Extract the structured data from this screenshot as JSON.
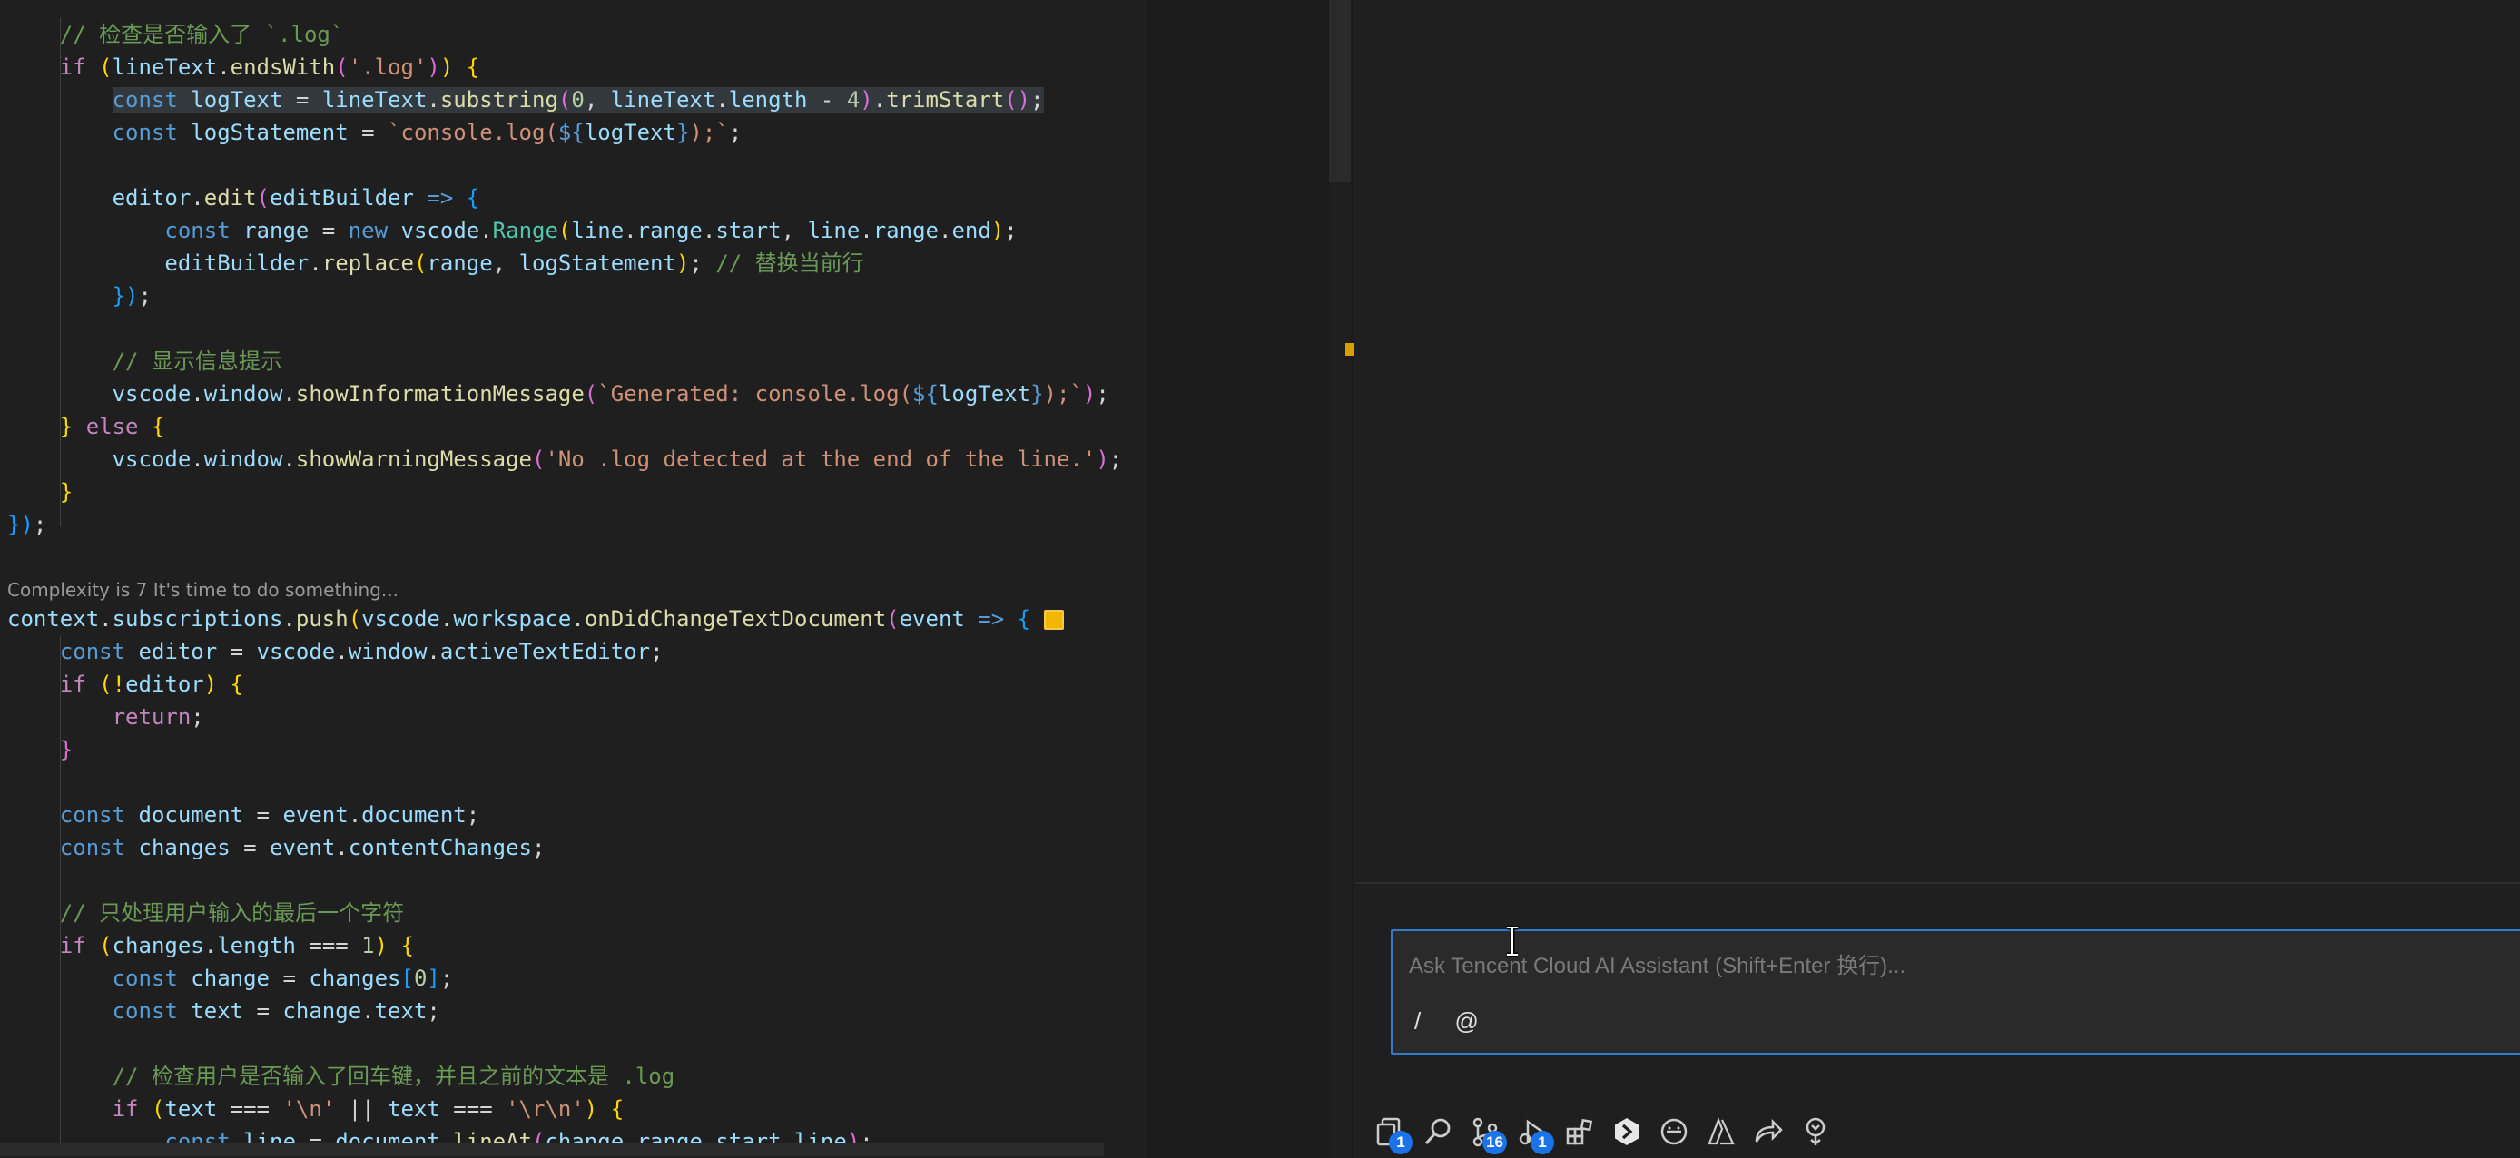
{
  "editor": {
    "codelens": "Complexity is 7 It's time to do something...",
    "lines_top": [
      [
        [
          "    ",
          "pl"
        ],
        [
          "// 检查是否输入了 `.log`",
          "cmt"
        ]
      ],
      [
        [
          "    ",
          "pl"
        ],
        [
          "if",
          "ctl"
        ],
        [
          " (",
          "p1"
        ],
        [
          "lineText",
          "var"
        ],
        [
          ".",
          "pl"
        ],
        [
          "endsWith",
          "fn"
        ],
        [
          "(",
          "p2"
        ],
        [
          "'.log'",
          "str"
        ],
        [
          ")",
          "p2"
        ],
        [
          ")",
          "p1"
        ],
        [
          " {",
          "p1"
        ]
      ],
      [
        [
          "        ",
          "pl"
        ],
        [
          "const",
          "kw"
        ],
        [
          " ",
          "pl"
        ],
        [
          "logText",
          "var"
        ],
        [
          " = ",
          "pl"
        ],
        [
          "lineText",
          "var"
        ],
        [
          ".",
          "pl"
        ],
        [
          "substring",
          "fn"
        ],
        [
          "(",
          "p2"
        ],
        [
          "0",
          "num"
        ],
        [
          ", ",
          "pl"
        ],
        [
          "lineText",
          "var"
        ],
        [
          ".",
          "pl"
        ],
        [
          "length",
          "var"
        ],
        [
          " - ",
          "pl"
        ],
        [
          "4",
          "num"
        ],
        [
          ")",
          "p2"
        ],
        [
          ".",
          "pl"
        ],
        [
          "trimStart",
          "fn"
        ],
        [
          "()",
          "p2"
        ],
        [
          ";",
          "pl"
        ]
      ],
      [
        [
          "        ",
          "pl"
        ],
        [
          "const",
          "kw"
        ],
        [
          " ",
          "pl"
        ],
        [
          "logStatement",
          "var"
        ],
        [
          " = ",
          "pl"
        ],
        [
          "`console.log(",
          "str"
        ],
        [
          "${",
          "kw"
        ],
        [
          "logText",
          "var"
        ],
        [
          "}",
          "kw"
        ],
        [
          ");`",
          "str"
        ],
        [
          ";",
          "pl"
        ]
      ],
      [],
      [
        [
          "        ",
          "pl"
        ],
        [
          "editor",
          "var"
        ],
        [
          ".",
          "pl"
        ],
        [
          "edit",
          "fn"
        ],
        [
          "(",
          "p2"
        ],
        [
          "editBuilder",
          "var"
        ],
        [
          " => ",
          "kw"
        ],
        [
          "{",
          "p3"
        ]
      ],
      [
        [
          "            ",
          "pl"
        ],
        [
          "const",
          "kw"
        ],
        [
          " ",
          "pl"
        ],
        [
          "range",
          "var"
        ],
        [
          " = ",
          "pl"
        ],
        [
          "new",
          "kw"
        ],
        [
          " ",
          "pl"
        ],
        [
          "vscode",
          "var"
        ],
        [
          ".",
          "pl"
        ],
        [
          "Range",
          "cls"
        ],
        [
          "(",
          "p1"
        ],
        [
          "line",
          "var"
        ],
        [
          ".",
          "pl"
        ],
        [
          "range",
          "var"
        ],
        [
          ".",
          "pl"
        ],
        [
          "start",
          "var"
        ],
        [
          ", ",
          "pl"
        ],
        [
          "line",
          "var"
        ],
        [
          ".",
          "pl"
        ],
        [
          "range",
          "var"
        ],
        [
          ".",
          "pl"
        ],
        [
          "end",
          "var"
        ],
        [
          ")",
          "p1"
        ],
        [
          ";",
          "pl"
        ]
      ],
      [
        [
          "            ",
          "pl"
        ],
        [
          "editBuilder",
          "var"
        ],
        [
          ".",
          "pl"
        ],
        [
          "replace",
          "fn"
        ],
        [
          "(",
          "p1"
        ],
        [
          "range",
          "var"
        ],
        [
          ", ",
          "pl"
        ],
        [
          "logStatement",
          "var"
        ],
        [
          ")",
          "p1"
        ],
        [
          "; ",
          "pl"
        ],
        [
          "// 替换当前行",
          "cmt"
        ]
      ],
      [
        [
          "        ",
          "pl"
        ],
        [
          "})",
          "p3"
        ],
        [
          ";",
          "pl"
        ]
      ],
      [],
      [
        [
          "        ",
          "pl"
        ],
        [
          "// 显示信息提示",
          "cmt"
        ]
      ],
      [
        [
          "        ",
          "pl"
        ],
        [
          "vscode",
          "var"
        ],
        [
          ".",
          "pl"
        ],
        [
          "window",
          "var"
        ],
        [
          ".",
          "pl"
        ],
        [
          "showInformationMessage",
          "fn"
        ],
        [
          "(",
          "p2"
        ],
        [
          "`Generated: console.log(",
          "str"
        ],
        [
          "${",
          "kw"
        ],
        [
          "logText",
          "var"
        ],
        [
          "}",
          "kw"
        ],
        [
          ");`",
          "str"
        ],
        [
          ")",
          "p2"
        ],
        [
          ";",
          "pl"
        ]
      ],
      [
        [
          "    ",
          "pl"
        ],
        [
          "}",
          "p1"
        ],
        [
          " ",
          "pl"
        ],
        [
          "else",
          "ctl"
        ],
        [
          " ",
          "pl"
        ],
        [
          "{",
          "p1"
        ]
      ],
      [
        [
          "        ",
          "pl"
        ],
        [
          "vscode",
          "var"
        ],
        [
          ".",
          "pl"
        ],
        [
          "window",
          "var"
        ],
        [
          ".",
          "pl"
        ],
        [
          "showWarningMessage",
          "fn"
        ],
        [
          "(",
          "p2"
        ],
        [
          "'No .log detected at the end of the line.'",
          "str"
        ],
        [
          ")",
          "p2"
        ],
        [
          ";",
          "pl"
        ]
      ],
      [
        [
          "    ",
          "pl"
        ],
        [
          "}",
          "p1"
        ]
      ],
      [
        [
          "})",
          "p3"
        ],
        [
          ";",
          "pl"
        ]
      ]
    ],
    "lines_bottom": [
      [
        [
          "context",
          "var"
        ],
        [
          ".",
          "pl"
        ],
        [
          "subscriptions",
          "var"
        ],
        [
          ".",
          "pl"
        ],
        [
          "push",
          "fn"
        ],
        [
          "(",
          "p1"
        ],
        [
          "vscode",
          "var"
        ],
        [
          ".",
          "pl"
        ],
        [
          "workspace",
          "var"
        ],
        [
          ".",
          "pl"
        ],
        [
          "onDidChangeTextDocument",
          "fn"
        ],
        [
          "(",
          "p2"
        ],
        [
          "event",
          "var"
        ],
        [
          " => ",
          "kw"
        ],
        [
          "{",
          "p3"
        ],
        [
          " ",
          "pl"
        ]
      ],
      [
        [
          "    ",
          "pl"
        ],
        [
          "const",
          "kw"
        ],
        [
          " ",
          "pl"
        ],
        [
          "editor",
          "var"
        ],
        [
          " = ",
          "pl"
        ],
        [
          "vscode",
          "var"
        ],
        [
          ".",
          "pl"
        ],
        [
          "window",
          "var"
        ],
        [
          ".",
          "pl"
        ],
        [
          "activeTextEditor",
          "var"
        ],
        [
          ";",
          "pl"
        ]
      ],
      [
        [
          "    ",
          "pl"
        ],
        [
          "if",
          "ctl"
        ],
        [
          " (!",
          "p1"
        ],
        [
          "editor",
          "var"
        ],
        [
          ")",
          "p1"
        ],
        [
          " {",
          "p1"
        ]
      ],
      [
        [
          "        ",
          "pl"
        ],
        [
          "return",
          "ctl"
        ],
        [
          ";",
          "pl"
        ]
      ],
      [
        [
          "    ",
          "pl"
        ],
        [
          "}",
          "p2"
        ]
      ],
      [],
      [
        [
          "    ",
          "pl"
        ],
        [
          "const",
          "kw"
        ],
        [
          " ",
          "pl"
        ],
        [
          "document",
          "var"
        ],
        [
          " = ",
          "pl"
        ],
        [
          "event",
          "var"
        ],
        [
          ".",
          "pl"
        ],
        [
          "document",
          "var"
        ],
        [
          ";",
          "pl"
        ]
      ],
      [
        [
          "    ",
          "pl"
        ],
        [
          "const",
          "kw"
        ],
        [
          " ",
          "pl"
        ],
        [
          "changes",
          "var"
        ],
        [
          " = ",
          "pl"
        ],
        [
          "event",
          "var"
        ],
        [
          ".",
          "pl"
        ],
        [
          "contentChanges",
          "var"
        ],
        [
          ";",
          "pl"
        ]
      ],
      [],
      [
        [
          "    ",
          "pl"
        ],
        [
          "// 只处理用户输入的最后一个字符",
          "cmt"
        ]
      ],
      [
        [
          "    ",
          "pl"
        ],
        [
          "if",
          "ctl"
        ],
        [
          " (",
          "p1"
        ],
        [
          "changes",
          "var"
        ],
        [
          ".",
          "pl"
        ],
        [
          "length",
          "var"
        ],
        [
          " === ",
          "pl"
        ],
        [
          "1",
          "num"
        ],
        [
          ")",
          "p1"
        ],
        [
          " {",
          "p1"
        ]
      ],
      [
        [
          "        ",
          "pl"
        ],
        [
          "const",
          "kw"
        ],
        [
          " ",
          "pl"
        ],
        [
          "change",
          "var"
        ],
        [
          " = ",
          "pl"
        ],
        [
          "changes",
          "var"
        ],
        [
          "[",
          "p3"
        ],
        [
          "0",
          "num"
        ],
        [
          "]",
          "p3"
        ],
        [
          ";",
          "pl"
        ]
      ],
      [
        [
          "        ",
          "pl"
        ],
        [
          "const",
          "kw"
        ],
        [
          " ",
          "pl"
        ],
        [
          "text",
          "var"
        ],
        [
          " = ",
          "pl"
        ],
        [
          "change",
          "var"
        ],
        [
          ".",
          "pl"
        ],
        [
          "text",
          "var"
        ],
        [
          ";",
          "pl"
        ]
      ],
      [],
      [
        [
          "        ",
          "pl"
        ],
        [
          "// 检查用户是否输入了回车键，并且之前的文本是 .log",
          "cmt"
        ]
      ],
      [
        [
          "        ",
          "pl"
        ],
        [
          "if",
          "ctl"
        ],
        [
          " (",
          "p1"
        ],
        [
          "text",
          "var"
        ],
        [
          " === ",
          "pl"
        ],
        [
          "'\\n'",
          "str"
        ],
        [
          " || ",
          "pl"
        ],
        [
          "text",
          "var"
        ],
        [
          " === ",
          "pl"
        ],
        [
          "'\\r\\n'",
          "str"
        ],
        [
          ")",
          "p1"
        ],
        [
          " {",
          "p1"
        ]
      ],
      [
        [
          "            ",
          "pl"
        ],
        [
          "const",
          "kw"
        ],
        [
          " ",
          "pl"
        ],
        [
          "line",
          "var"
        ],
        [
          " = ",
          "pl"
        ],
        [
          "document",
          "var"
        ],
        [
          ".",
          "pl"
        ],
        [
          "lineAt",
          "fn"
        ],
        [
          "(",
          "p2"
        ],
        [
          "change",
          "var"
        ],
        [
          ".",
          "pl"
        ],
        [
          "range",
          "var"
        ],
        [
          ".",
          "pl"
        ],
        [
          "start",
          "var"
        ],
        [
          ".",
          "pl"
        ],
        [
          "line",
          "var"
        ],
        [
          ")",
          "p2"
        ],
        [
          ";",
          "pl"
        ]
      ]
    ]
  },
  "chat": {
    "placeholder": "Ask Tencent Cloud AI Assistant (Shift+Enter 换行)...",
    "slash": "/",
    "at": "@"
  },
  "activity_bar": [
    {
      "name": "explorer-icon",
      "badge": "1"
    },
    {
      "name": "search-icon",
      "badge": ""
    },
    {
      "name": "source-control-icon",
      "badge": "16"
    },
    {
      "name": "run-debug-icon",
      "badge": "1"
    },
    {
      "name": "extensions-icon",
      "badge": ""
    },
    {
      "name": "codebuddy-icon",
      "badge": ""
    },
    {
      "name": "comment-icon",
      "badge": ""
    },
    {
      "name": "azure-icon",
      "badge": ""
    },
    {
      "name": "live-share-icon",
      "badge": ""
    },
    {
      "name": "git-tree-icon",
      "badge": ""
    }
  ],
  "colors": {
    "editor_bg": "#1f1f1f",
    "accent_blue": "#2f7bd2",
    "badge_blue": "#1a73e8",
    "scroll_marker": "#d7a000"
  }
}
